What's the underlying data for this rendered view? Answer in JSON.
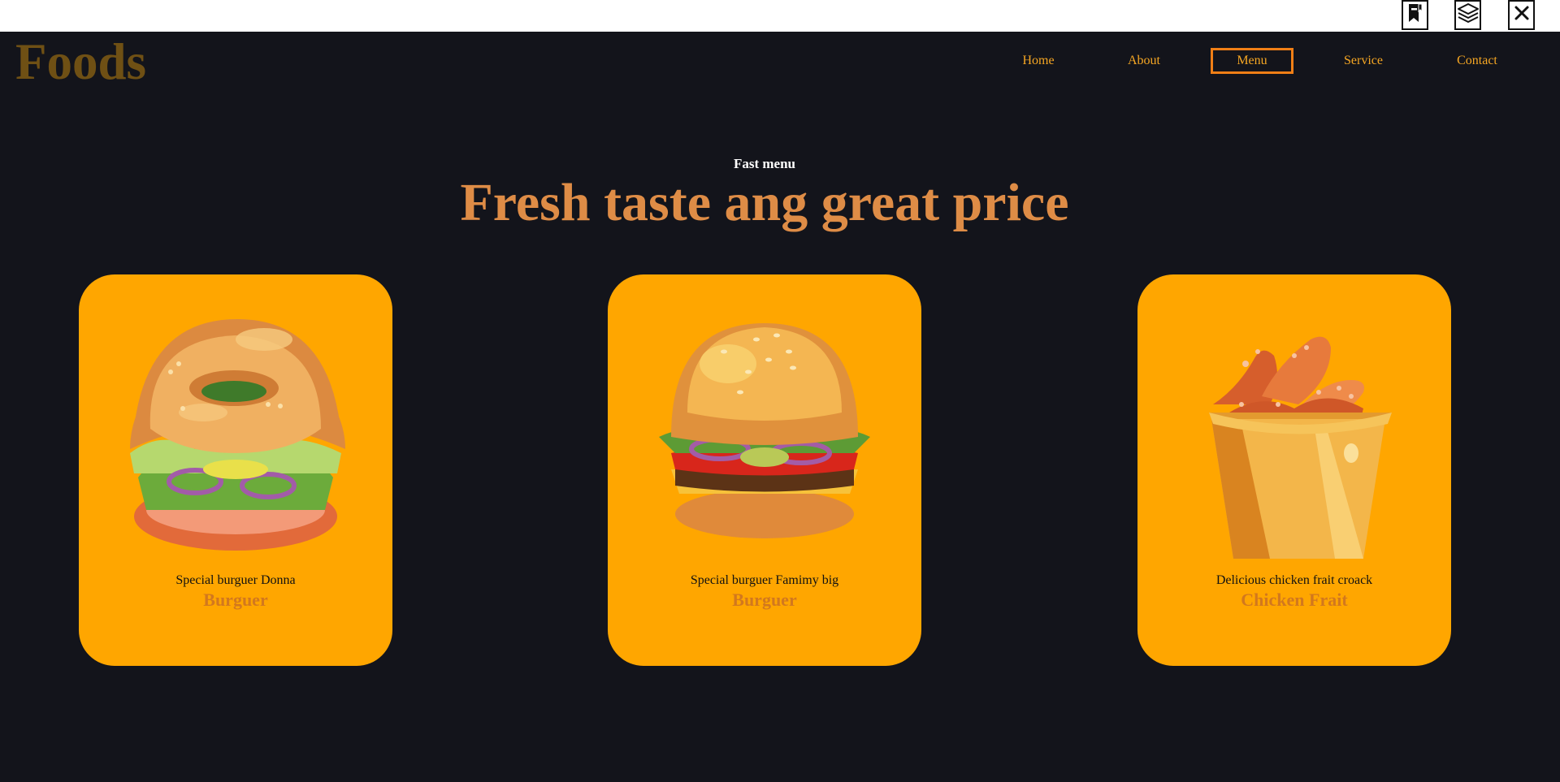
{
  "toolbar": {
    "icons": [
      "bookmark-icon",
      "layers-icon",
      "close-icon"
    ]
  },
  "brand": {
    "logo": "Foods"
  },
  "nav": {
    "items": [
      {
        "label": "Home"
      },
      {
        "label": "About"
      },
      {
        "label": "Menu"
      },
      {
        "label": "Service"
      },
      {
        "label": "Contact"
      }
    ],
    "active": "Menu"
  },
  "hero": {
    "subtitle": "Fast menu",
    "headline": "Fresh taste ang great price"
  },
  "cards": [
    {
      "description": "Special burguer Donna",
      "title": "Burguer",
      "image": "bagel-burger-illustration"
    },
    {
      "description": "Special burguer Famimy big",
      "title": "Burguer",
      "image": "cheeseburger-illustration"
    },
    {
      "description": "Delicious chicken frait croack",
      "title": "Chicken Frait",
      "image": "fried-chicken-bucket-illustration"
    }
  ],
  "colors": {
    "background": "#13141b",
    "card": "#ffa600",
    "accent": "#f5a623",
    "headline": "#de8c46",
    "logo": "#6f5014",
    "card_title": "#d2781e"
  }
}
